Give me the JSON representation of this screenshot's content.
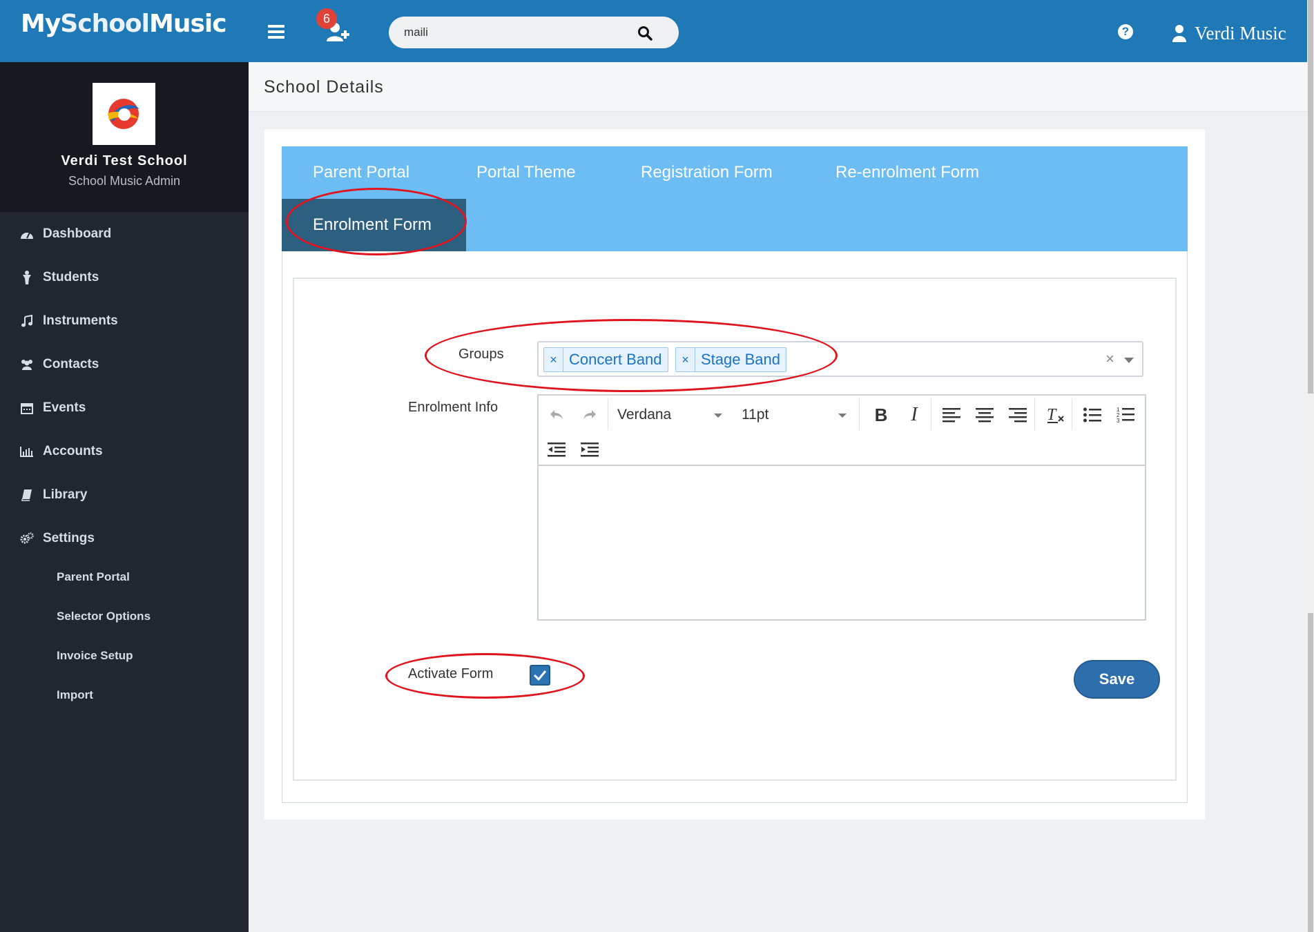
{
  "header": {
    "logo": {
      "my": "My",
      "school": "School",
      "music": "Music"
    },
    "notification_count": "6",
    "search": {
      "value": "maili",
      "placeholder": ""
    },
    "help_label": "?",
    "user_name": "Verdi Music"
  },
  "sidebar": {
    "school_name": "Verdi Test School",
    "school_role": "School Music Admin",
    "items": [
      {
        "label": "Dashboard",
        "icon": "dashboard-icon"
      },
      {
        "label": "Students",
        "icon": "student-icon"
      },
      {
        "label": "Instruments",
        "icon": "music-note-icon"
      },
      {
        "label": "Contacts",
        "icon": "users-icon"
      },
      {
        "label": "Events",
        "icon": "calendar-icon"
      },
      {
        "label": "Accounts",
        "icon": "bar-chart-icon"
      },
      {
        "label": "Library",
        "icon": "book-icon"
      },
      {
        "label": "Settings",
        "icon": "gears-icon"
      }
    ],
    "sub_items": [
      {
        "label": "Parent Portal"
      },
      {
        "label": "Selector Options"
      },
      {
        "label": "Invoice Setup"
      },
      {
        "label": "Import"
      }
    ]
  },
  "page": {
    "title": "School Details"
  },
  "tabs": [
    {
      "label": "Parent Portal",
      "active": false
    },
    {
      "label": "Portal Theme",
      "active": false
    },
    {
      "label": "Registration Form",
      "active": false
    },
    {
      "label": "Re-enrolment Form",
      "active": false
    },
    {
      "label": "Enrolment Form",
      "active": true
    }
  ],
  "form": {
    "groups_label": "Groups",
    "groups": [
      "Concert Band",
      "Stage Band"
    ],
    "tag_remove": "×",
    "clear_all": "×",
    "enrolment_info_label": "Enrolment Info",
    "editor": {
      "font": "Verdana",
      "size": "11pt",
      "bold": "B",
      "italic": "I",
      "clear_format": "T",
      "content": ""
    },
    "activate_label": "Activate Form",
    "activate_checked": true,
    "save_label": "Save"
  },
  "annotation_color": "#e0141e",
  "accent_color": "#2079b7"
}
